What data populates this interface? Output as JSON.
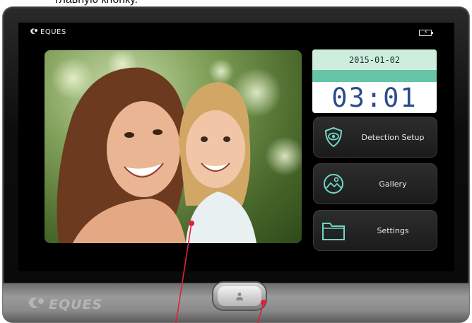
{
  "caption": "главную кнопку.",
  "device": {
    "brand": "EQUES",
    "status_icons": [
      "battery-charging-icon"
    ]
  },
  "clock": {
    "date": "2015-01-02",
    "time": "03:01"
  },
  "menu": {
    "items": [
      {
        "label": "Detection Setup",
        "icon": "eye-shield-icon"
      },
      {
        "label": "Gallery",
        "icon": "gallery-icon"
      },
      {
        "label": "Settings",
        "icon": "folder-icon"
      }
    ]
  },
  "colors": {
    "date_panel_top": "#cdeedd",
    "date_panel_band": "#66c5a7",
    "time_text": "#2b4b8a",
    "icon_accent": "#6fd6c0",
    "annotation_arrow": "#e0203a"
  }
}
